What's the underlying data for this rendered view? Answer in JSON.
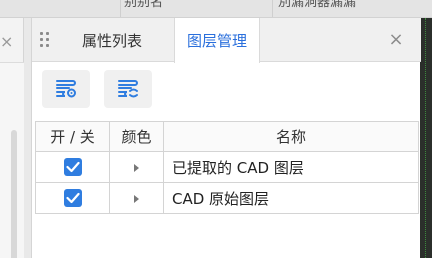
{
  "background_header": {
    "cell_a": "别别名",
    "cell_b": "別漏洞器漏漏"
  },
  "panel": {
    "tabs": [
      {
        "label": "属性列表",
        "active": false
      },
      {
        "label": "图层管理",
        "active": true
      }
    ],
    "close_glyph": "×",
    "accent_color": "#2a6fdc"
  },
  "table": {
    "headers": {
      "toggle": "开 / 关",
      "color": "颜色",
      "name": "名称"
    },
    "rows": [
      {
        "checked": true,
        "name": "已提取的 CAD 图层"
      },
      {
        "checked": true,
        "name": "CAD 原始图层"
      }
    ]
  },
  "icons": {
    "toolbar_1": "layers-toggle-icon",
    "toolbar_2": "layers-refresh-icon",
    "checkbox": "check-icon",
    "expand": "caret-right-icon"
  },
  "left_panel": {
    "close_glyph": "×"
  }
}
